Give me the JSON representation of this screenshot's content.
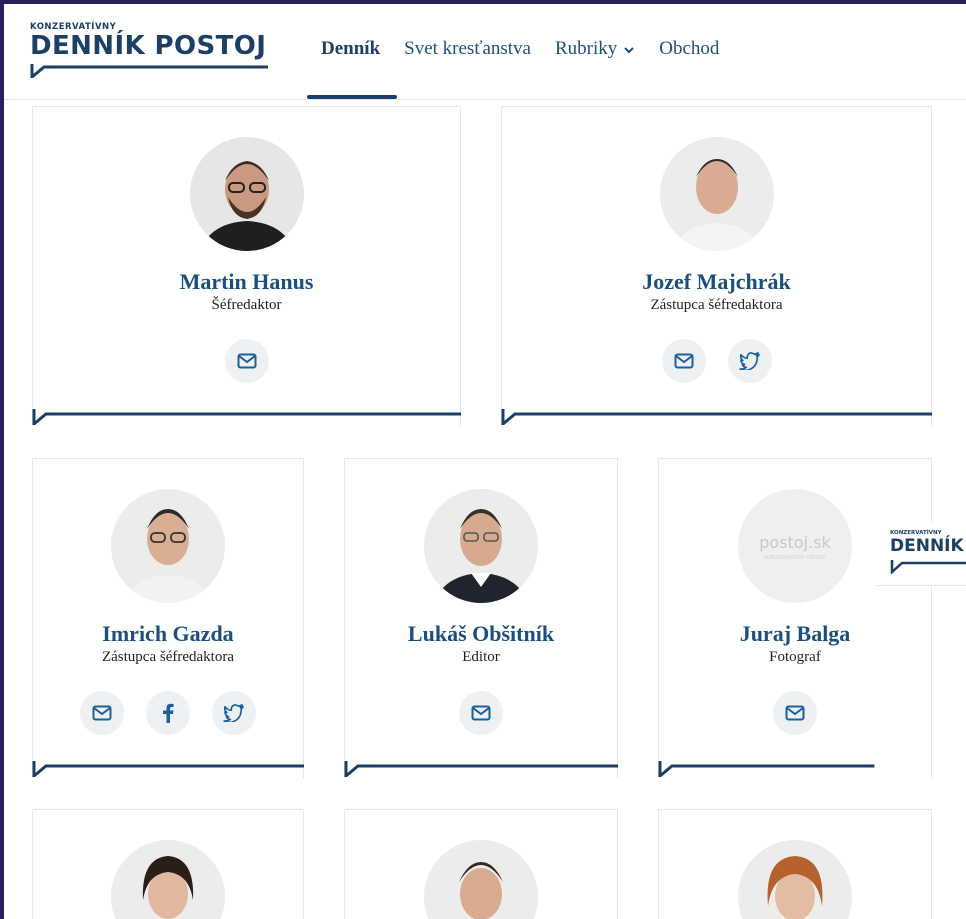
{
  "header": {
    "logo_small": "KONZERVATÍVNY",
    "logo_big": "DENNÍK POSTOJ",
    "nav": [
      {
        "label": "Denník"
      },
      {
        "label": "Svet kresťanstva"
      },
      {
        "label": "Rubriky"
      },
      {
        "label": "Obchod"
      }
    ]
  },
  "people": [
    {
      "name": "Martin Hanus",
      "role": "Šéfredaktor"
    },
    {
      "name": "Jozef Majchrák",
      "role": "Zástupca šéfredaktora"
    },
    {
      "name": "Imrich Gazda",
      "role": "Zástupca šéfredaktora"
    },
    {
      "name": "Lukáš Obšitník",
      "role": "Editor"
    },
    {
      "name": "Juraj Balga",
      "role": "Fotograf"
    }
  ],
  "placeholder": {
    "text": "postoj.sk",
    "sub": "KONZERVATÍVNY DENNÍK"
  },
  "float_logo": {
    "small": "KONZERVATÍVNY",
    "big": "DENNÍK"
  },
  "colors": {
    "brand": "#1c3f66",
    "link": "#1c4f7e",
    "icon_bg": "#eef1f4"
  }
}
